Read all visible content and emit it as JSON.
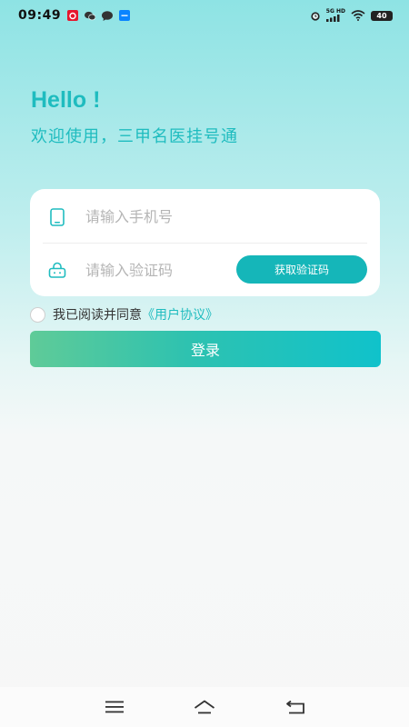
{
  "status_bar": {
    "time": "09:49",
    "network_label_top": "5G HD",
    "battery": "40",
    "notification_icons": [
      "weibo-icon",
      "wechat-icon",
      "message-icon",
      "zhihu-icon"
    ]
  },
  "header": {
    "greeting": "Hello !",
    "welcome": "欢迎使用，三甲名医挂号通"
  },
  "form": {
    "phone_placeholder": "请输入手机号",
    "code_placeholder": "请输入验证码",
    "get_code_label": "获取验证码"
  },
  "agreement": {
    "text": "我已阅读并同意",
    "link": "《用户协议》",
    "checked": false
  },
  "login_label": "登录",
  "colors": {
    "accent": "#1fbcbf",
    "button_start": "#5fcb98",
    "button_end": "#10c2cb"
  },
  "nav_icons": [
    "menu-icon",
    "home-icon",
    "back-icon"
  ]
}
